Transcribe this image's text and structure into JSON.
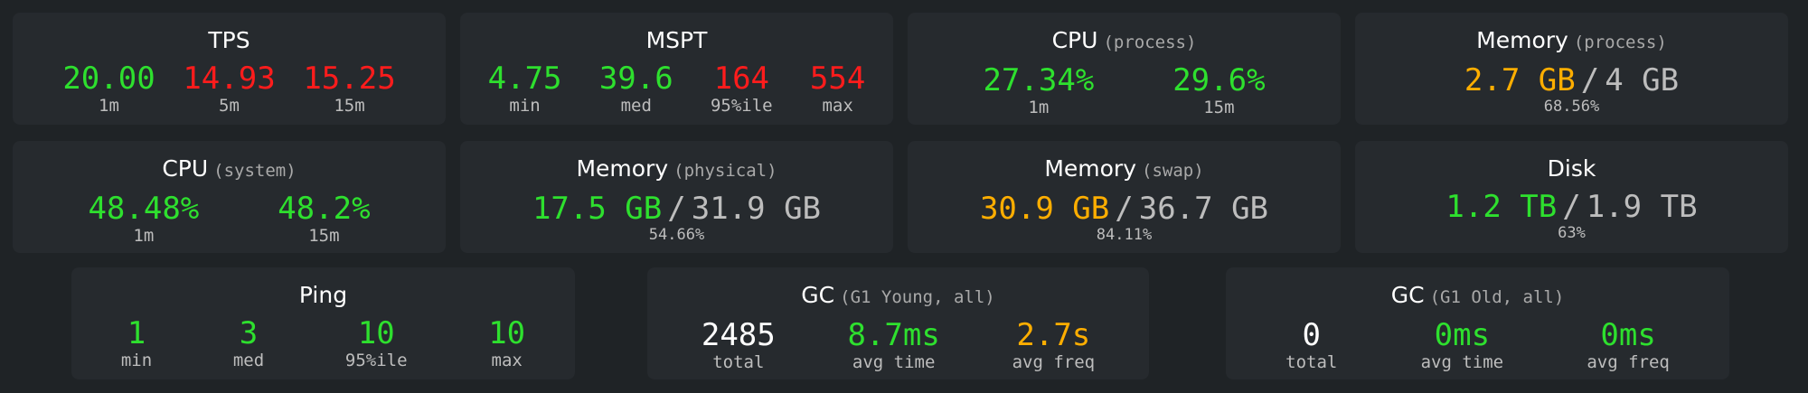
{
  "colors": {
    "good": "#2ee02e",
    "bad": "#ff1c1c",
    "warn": "#ffae00",
    "background": "#1f2326",
    "card": "#262a2e"
  },
  "tps": {
    "title": "TPS",
    "stats": [
      {
        "value": "20.00",
        "label": "1m",
        "status": "good"
      },
      {
        "value": "14.93",
        "label": "5m",
        "status": "bad"
      },
      {
        "value": "15.25",
        "label": "15m",
        "status": "bad"
      }
    ]
  },
  "mspt": {
    "title": "MSPT",
    "stats": [
      {
        "value": "4.75",
        "label": "min"
      },
      {
        "value": "39.6",
        "label": "med"
      },
      {
        "value": "164",
        "label": "95%ile"
      },
      {
        "value": "554",
        "label": "max"
      }
    ]
  },
  "cpu_process": {
    "title": "CPU",
    "subtitle": "(process)",
    "stats": [
      {
        "value": "27.34%",
        "label": "1m"
      },
      {
        "value": "29.6%",
        "label": "15m"
      }
    ]
  },
  "memory_process": {
    "title": "Memory",
    "subtitle": "(process)",
    "used": "2.7 GB",
    "sep": "/",
    "total": "4 GB",
    "percent": "68.56%"
  },
  "cpu_system": {
    "title": "CPU",
    "subtitle": "(system)",
    "stats": [
      {
        "value": "48.48%",
        "label": "1m"
      },
      {
        "value": "48.2%",
        "label": "15m"
      }
    ]
  },
  "memory_physical": {
    "title": "Memory",
    "subtitle": "(physical)",
    "used": "17.5 GB",
    "sep": "/",
    "total": "31.9 GB",
    "percent": "54.66%"
  },
  "memory_swap": {
    "title": "Memory",
    "subtitle": "(swap)",
    "used": "30.9 GB",
    "sep": "/",
    "total": "36.7 GB",
    "percent": "84.11%"
  },
  "disk": {
    "title": "Disk",
    "used": "1.2 TB",
    "sep": "/",
    "total": "1.9 TB",
    "percent": "63%"
  },
  "ping": {
    "title": "Ping",
    "stats": [
      {
        "value": "1",
        "label": "min"
      },
      {
        "value": "3",
        "label": "med"
      },
      {
        "value": "10",
        "label": "95%ile"
      },
      {
        "value": "10",
        "label": "max"
      }
    ]
  },
  "gc_young": {
    "title": "GC",
    "subtitle": "(G1 Young, all)",
    "stats": [
      {
        "value": "2485",
        "label": "total"
      },
      {
        "value": "8.7ms",
        "label": "avg time"
      },
      {
        "value": "2.7s",
        "label": "avg freq"
      }
    ]
  },
  "gc_old": {
    "title": "GC",
    "subtitle": "(G1 Old, all)",
    "stats": [
      {
        "value": "0",
        "label": "total"
      },
      {
        "value": "0ms",
        "label": "avg time"
      },
      {
        "value": "0ms",
        "label": "avg freq"
      }
    ]
  }
}
